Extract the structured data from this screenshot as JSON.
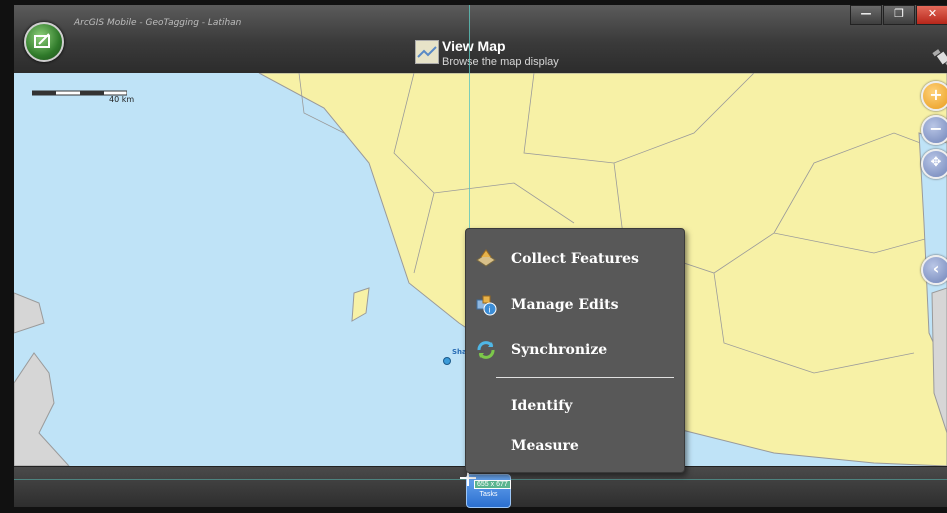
{
  "window": {
    "app_title": "ArcGIS Mobile - GeoTagging - Latihan",
    "controls": {
      "minimize": "—",
      "maximize": "❐",
      "close": "✕"
    }
  },
  "header": {
    "title": "View Map",
    "subtitle": "Browse the map display"
  },
  "map": {
    "scale_label": "40 km",
    "place_label": "Shah A",
    "colors": {
      "water": "#bfe3f7",
      "land": "#f7f1a6",
      "border": "#9a9a9a"
    },
    "zoom_controls": [
      {
        "name": "zoom-in",
        "glyph": "+"
      },
      {
        "name": "zoom-out",
        "glyph": "−"
      },
      {
        "name": "pan",
        "glyph": "✥"
      },
      {
        "name": "collapse",
        "glyph": "‹"
      }
    ]
  },
  "menu": {
    "items": [
      {
        "label": "Collect Features",
        "icon": "collect-features-icon"
      },
      {
        "label": "Manage Edits",
        "icon": "manage-edits-icon"
      },
      {
        "label": "Synchronize",
        "icon": "synchronize-icon"
      },
      {
        "label": "Identify"
      },
      {
        "label": "Measure"
      }
    ]
  },
  "taskbar": {
    "tasks_label": "Tasks",
    "size_tooltip": "655 x 677"
  }
}
